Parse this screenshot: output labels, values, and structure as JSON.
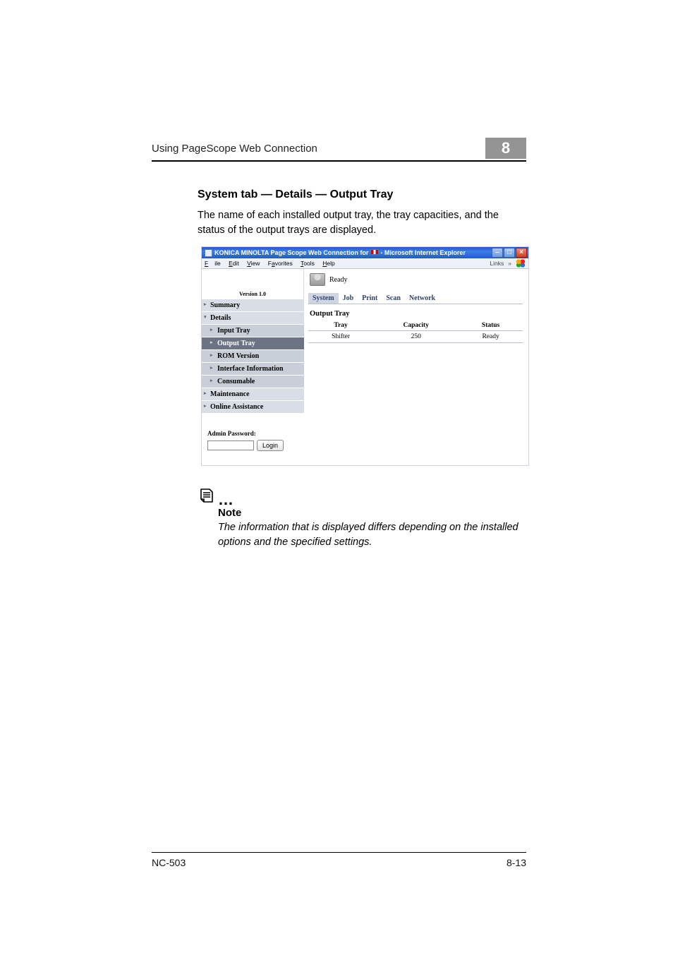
{
  "header": {
    "running": "Using PageScope Web Connection",
    "chapter": "8"
  },
  "section": {
    "title": "System tab — Details — Output Tray",
    "desc": "The name of each installed output tray, the tray capacities, and the status of the output trays are displayed."
  },
  "shot": {
    "title_prefix": "KONICA MINOLTA Page Scope Web Connection for ",
    "title_suffix": " - Microsoft Internet Explorer",
    "menubar": {
      "file": "File",
      "edit": "Edit",
      "view": "View",
      "favorites": "Favorites",
      "tools": "Tools",
      "help": "Help",
      "links": "Links"
    },
    "winbtn_min": "–",
    "winbtn_max": "□",
    "winbtn_close": "×",
    "menubar_chevron": "»",
    "brand_version": "Version 1.0",
    "status": "Ready",
    "tabs": [
      "System",
      "Job",
      "Print",
      "Scan",
      "Network"
    ],
    "nav": {
      "summary": "Summary",
      "details": "Details",
      "input_tray": "Input Tray",
      "output_tray": "Output Tray",
      "rom": "ROM Version",
      "iface": "Interface Information",
      "consumable": "Consumable",
      "maintenance": "Maintenance",
      "online": "Online Assistance"
    },
    "admin": {
      "label": "Admin Password:",
      "button": "Login"
    },
    "panel": {
      "title": "Output Tray",
      "cols": {
        "tray": "Tray",
        "capacity": "Capacity",
        "status": "Status"
      },
      "rows": [
        {
          "tray": "Shifter",
          "capacity": "250",
          "status": "Ready"
        }
      ]
    }
  },
  "note": {
    "dots": "…",
    "heading": "Note",
    "body": "The information that is displayed differs depending on the installed options and the specified settings."
  },
  "footer": {
    "left": "NC-503",
    "right": "8-13"
  }
}
